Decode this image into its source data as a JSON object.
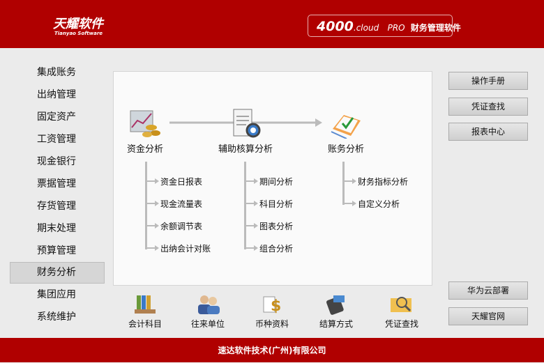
{
  "header": {
    "logo": "天耀软件",
    "logo_sub": "Tianyao Software",
    "product_num": "4000",
    "product_cloud": ".cloud",
    "product_pro": "PRO",
    "product_name": "财务管理软件"
  },
  "menu": [
    "集成账务",
    "出纳管理",
    "固定资产",
    "工资管理",
    "现金银行",
    "票据管理",
    "存货管理",
    "期末处理",
    "预算管理",
    "财务分析",
    "集团应用",
    "系统维护"
  ],
  "active_menu": "财务分析",
  "tree": [
    {
      "label": "资金分析",
      "items": [
        "资金日报表",
        "现金流量表",
        "余额调节表",
        "出纳会计对账"
      ]
    },
    {
      "label": "辅助核算分析",
      "items": [
        "期间分析",
        "科目分析",
        "图表分析",
        "组合分析"
      ]
    },
    {
      "label": "账务分析",
      "items": [
        "财务指标分析",
        "自定义分析"
      ]
    }
  ],
  "bottom": [
    "会计科目",
    "往来单位",
    "币种资料",
    "结算方式",
    "凭证查找"
  ],
  "right_top": [
    "操作手册",
    "凭证查找",
    "报表中心"
  ],
  "right_bottom": [
    "华为云部署",
    "天耀官网"
  ],
  "footer": "速达软件技术(广州)有限公司",
  "colors": {
    "brand": "#b00000"
  }
}
